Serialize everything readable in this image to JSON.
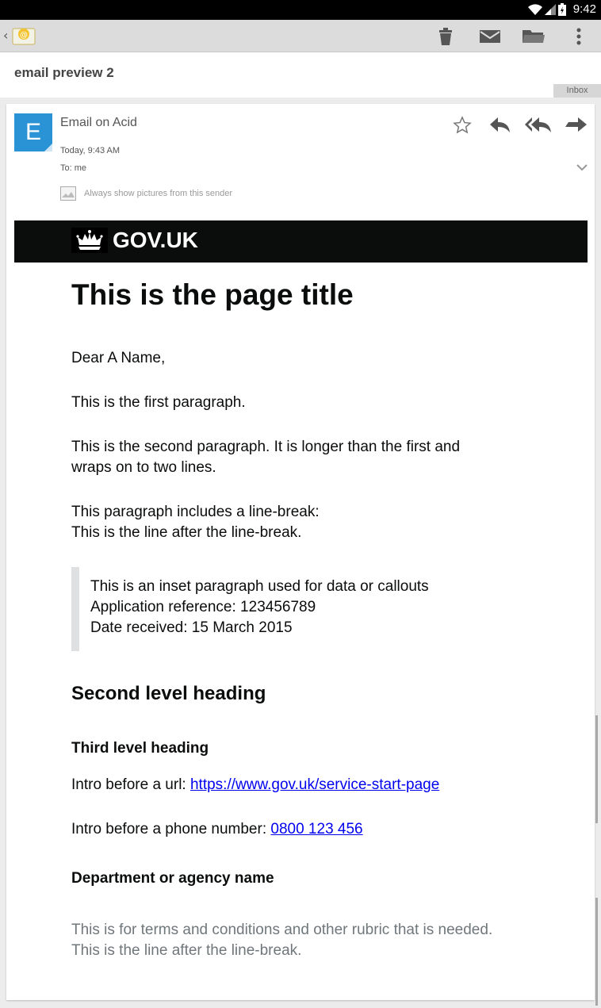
{
  "status_bar": {
    "time": "9:42"
  },
  "action_bar": {
    "back": "‹",
    "icons": [
      "delete-icon",
      "mark-unread-icon",
      "move-to-folder-icon",
      "overflow-menu-icon"
    ]
  },
  "subject": "email preview 2",
  "label": "Inbox",
  "message_header": {
    "avatar_letter": "E",
    "sender": "Email on Acid",
    "date": "Today, 9:43 AM",
    "to": "To: me",
    "show_pictures": "Always show pictures from this sender"
  },
  "email": {
    "brand": "GOV.UK",
    "title": "This is the page title",
    "greeting": "Dear A Name,",
    "para1": "This is the first paragraph.",
    "para2_line1": "This is the second paragraph. It is longer than the first and",
    "para2_line2": "wraps on to two lines.",
    "para3_line1": "This paragraph includes a line-break:",
    "para3_line2": "This is the line after the line-break.",
    "inset_line1": "This is an inset paragraph used for data or callouts",
    "inset_line2": "Application reference: 123456789",
    "inset_line3": "Date received: 15 March 2015",
    "h2": "Second level heading",
    "h3": "Third level heading",
    "url_intro": "Intro before a url: ",
    "url": "https://www.gov.uk/service-start-page",
    "phone_intro": "Intro before a phone number: ",
    "phone": "0800 123 456",
    "department": "Department or agency name",
    "rubric_line1": "This is for terms and conditions and other rubric that is needed.",
    "rubric_line2": "This is the line after the line-break."
  }
}
